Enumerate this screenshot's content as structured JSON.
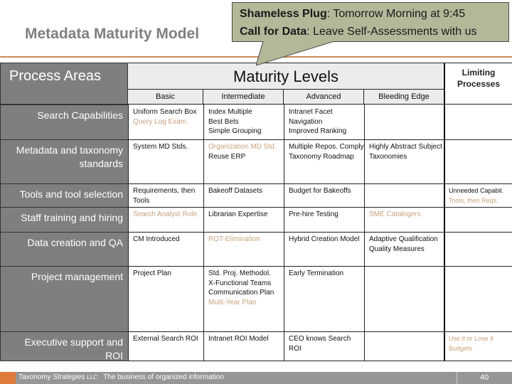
{
  "title": "Metadata Maturity Model",
  "callout": {
    "line1_label": "Shameless Plug",
    "line1_text": ": Tomorrow Morning at 9:45",
    "line2_label": "Call for Data",
    "line2_text": ": Leave Self-Assessments with us"
  },
  "table": {
    "process_areas_header": "Process Areas",
    "maturity_levels_header": "Maturity Levels",
    "limiting_header_line1": "Limiting",
    "limiting_header_line2": "Processes",
    "levels": [
      "Basic",
      "Intermediate",
      "Advanced",
      "Bleeding Edge"
    ],
    "rows": [
      {
        "label": "Search Capabilities",
        "basic": [
          {
            "text": "Uniform Search Box",
            "accent": false
          },
          {
            "text": "Query Log Exam.",
            "accent": true
          }
        ],
        "intermediate": [
          {
            "text": "Index Multiple",
            "accent": false
          },
          {
            "text": "Best Bets",
            "accent": false
          },
          {
            "text": "Simple Grouping",
            "accent": false
          }
        ],
        "advanced": [
          {
            "text": "Intranet Facet Navigation",
            "accent": false
          },
          {
            "text": "Improved Ranking",
            "accent": false
          }
        ],
        "bleeding": [],
        "limiting": []
      },
      {
        "label": "Metadata and taxonomy standards",
        "basic": [
          {
            "text": "System MD Stds.",
            "accent": false
          }
        ],
        "intermediate": [
          {
            "text": "Organization MD Std.",
            "accent": true
          },
          {
            "text": "Reuse ERP",
            "accent": false
          }
        ],
        "advanced": [
          {
            "text": "Multiple Repos. Comply",
            "accent": false
          },
          {
            "text": "Taxonomy Roadmap",
            "accent": false
          }
        ],
        "bleeding": [
          {
            "text": "Highly Abstract Subject",
            "accent": false
          },
          {
            "text": "Taxonomies",
            "accent": false
          }
        ],
        "limiting": []
      },
      {
        "label": "Tools and tool selection",
        "basic": [
          {
            "text": "Requirements, then Tools",
            "accent": false
          }
        ],
        "intermediate": [
          {
            "text": "Bakeoff Datasets",
            "accent": false
          }
        ],
        "advanced": [
          {
            "text": "Budget for Bakeoffs",
            "accent": false
          }
        ],
        "bleeding": [],
        "limiting": [
          {
            "text": "Unneeded Capabil.",
            "accent": false
          },
          {
            "text": "Tools, then Reqs.",
            "accent": true
          }
        ]
      },
      {
        "label": "Staff training and hiring",
        "basic": [
          {
            "text": "Search Analyst Role",
            "accent": true
          }
        ],
        "intermediate": [
          {
            "text": "Librarian Expertise",
            "accent": false
          }
        ],
        "advanced": [
          {
            "text": "Pre-hire Testing",
            "accent": false
          }
        ],
        "bleeding": [
          {
            "text": "SME Catalogers",
            "accent": true
          }
        ],
        "limiting": []
      },
      {
        "label": "Data creation and QA",
        "basic": [
          {
            "text": "CM Introduced",
            "accent": false
          }
        ],
        "intermediate": [
          {
            "text": "ROT-Elimination",
            "accent": true
          }
        ],
        "advanced": [
          {
            "text": "Hybrid Creation Model",
            "accent": false
          }
        ],
        "bleeding": [
          {
            "text": "Adaptive Qualification",
            "accent": false
          },
          {
            "text": "Quality Measures",
            "accent": false
          }
        ],
        "limiting": []
      },
      {
        "label": "Project management",
        "basic": [
          {
            "text": "Project Plan",
            "accent": false
          }
        ],
        "intermediate": [
          {
            "text": "Std. Proj. Methodol.",
            "accent": false
          },
          {
            "text": "X-Functional Teams",
            "accent": false
          },
          {
            "text": "Communication Plan",
            "accent": false
          },
          {
            "text": "Multi-Year Plan",
            "accent": true
          }
        ],
        "advanced": [
          {
            "text": "Early Termination",
            "accent": false
          }
        ],
        "bleeding": [],
        "limiting": []
      },
      {
        "label": "Executive support and ROI",
        "basic": [
          {
            "text": "External Search ROI",
            "accent": false
          }
        ],
        "intermediate": [
          {
            "text": "Intranet ROI Model",
            "accent": false
          }
        ],
        "advanced": [
          {
            "text": "CEO knows Search ROI",
            "accent": false
          }
        ],
        "bleeding": [],
        "limiting": [
          {
            "text": "Use it or Lose It Budgets",
            "accent": true
          }
        ]
      }
    ]
  },
  "footer": {
    "company": "Taxonomy",
    "company_italic": "Strategies",
    "company_suffix": "LLC",
    "tagline": "The business of organized information",
    "page_number": "40"
  },
  "colors": {
    "accent_text": "#c8a27c",
    "process_area_bg": "#7f7f7f",
    "callout_bg": "#b3b899",
    "rule": "#c98a5a"
  }
}
